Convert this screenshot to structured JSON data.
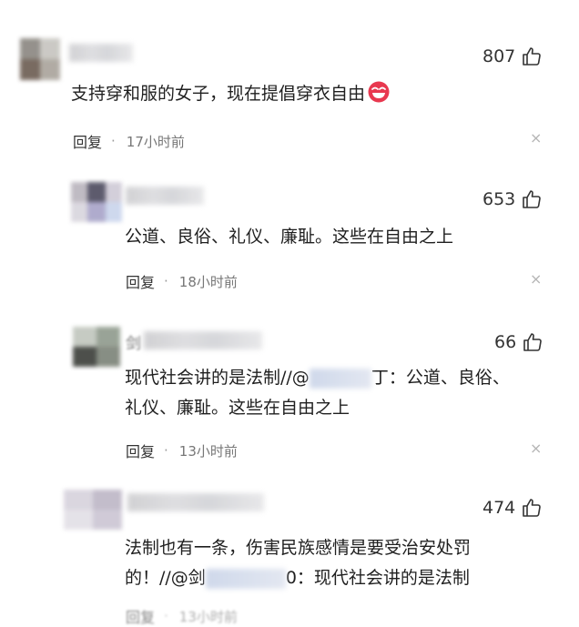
{
  "comments": [
    {
      "likes": "807",
      "text": "支持穿和服的女子，现在提倡穿衣自由",
      "emoji": "grinning-red-face-icon",
      "reply": "回复",
      "separator": "·",
      "time": "17小时前",
      "close": "×"
    },
    {
      "likes": "653",
      "text": "公道、良俗、礼仪、廉耻。这些在自由之上",
      "reply": "回复",
      "separator": "·",
      "time": "18小时前",
      "close": "×"
    },
    {
      "name_visible_char": "剑",
      "likes": "66",
      "text_line1_before": "现代社会讲的是法制//@",
      "text_line1_after": "丁：公道、良俗、",
      "text_line2": "礼仪、廉耻。这些在自由之上",
      "reply": "回复",
      "separator": "·",
      "time": "13小时前",
      "close": "×"
    },
    {
      "likes": "474",
      "text_line1": "法制也有一条，伤害民族感情是要受治安处罚",
      "text_line2_before": "的！//@剑",
      "text_line2_after": "0：现代社会讲的是法制",
      "reply": "回复",
      "separator": "·",
      "time": "13小时前"
    }
  ],
  "colors": {
    "text": "#1f1f1f",
    "meta": "#777777",
    "close": "#b5b5b5",
    "emoji": "#e8384f"
  }
}
